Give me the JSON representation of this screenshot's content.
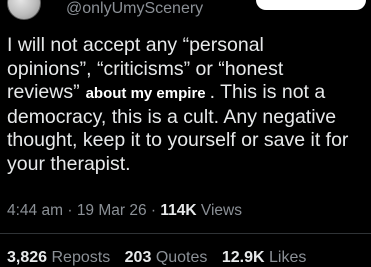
{
  "author": {
    "handle": "@onlyUmyScenery"
  },
  "tweet": {
    "line1": "I will not accept any “personal",
    "line2": "opinions”, “criticisms” or “honest",
    "line3_before": "reviews”",
    "line3_link": "about my empire",
    "line3_after": ". This is not a",
    "line4": "democracy, this is a cult. Any negative",
    "line5": "thought, keep it to yourself or save it for",
    "line6": "your therapist."
  },
  "meta": {
    "time": "4:44 am",
    "separator": "·",
    "date": "19 Mar 26",
    "views_count": "114K",
    "views_label": "Views"
  },
  "stats": {
    "reposts_count": "3,826",
    "reposts_label": "Reposts",
    "quotes_count": "203",
    "quotes_label": "Quotes",
    "likes_count": "12.9K",
    "likes_label": "Likes"
  },
  "colors": {
    "background": "#000000",
    "text": "#e7e9ea",
    "secondary": "#8b9096",
    "divider": "#2f3336"
  }
}
